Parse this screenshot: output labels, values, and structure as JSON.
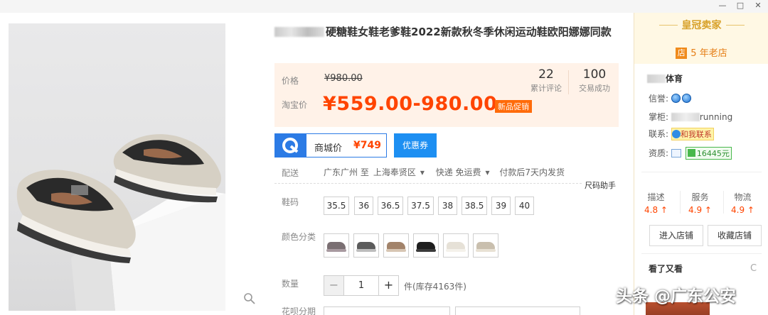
{
  "window": {
    "minimize_label": "—",
    "maximize_label": "□",
    "close_label": "✕"
  },
  "product": {
    "title": "硬糖鞋女鞋老爹鞋2022新款秋冬季休闲运动鞋欧阳娜娜同款",
    "price_label": "价格",
    "original_price": "¥980.00",
    "taobao_price_label": "淘宝价",
    "taobao_price": "¥559.00-980.00",
    "promo_tag": "新品促销",
    "reviews_count": "22",
    "reviews_label": "累计评论",
    "trades_count": "100",
    "trades_label": "交易成功",
    "mall_price_label": "商城价",
    "mall_price": "¥749",
    "coupon_label": "优惠券"
  },
  "delivery": {
    "label": "配送",
    "from": "广东广州 至",
    "to": "上海奉贤区",
    "express": "快递 免运费",
    "ship_time": "付款后7天内发货",
    "size_helper": "尺码助手"
  },
  "sizes": {
    "label": "鞋码",
    "options": [
      "35.5",
      "36",
      "36.5",
      "37.5",
      "38",
      "38.5",
      "39",
      "40"
    ]
  },
  "colors": {
    "label": "颜色分类",
    "swatches": [
      {
        "name": "swatch-1",
        "upper": "#7a6f72",
        "sole": "#a89aa0"
      },
      {
        "name": "swatch-2",
        "upper": "#5b5b5b",
        "sole": "#bdbdbd"
      },
      {
        "name": "swatch-3",
        "upper": "#a2836a",
        "sole": "#d7c6b3"
      },
      {
        "name": "swatch-4",
        "upper": "#1e1e1e",
        "sole": "#3a3a3a"
      },
      {
        "name": "swatch-5",
        "upper": "#e6e1d7",
        "sole": "#f4f1ea"
      },
      {
        "name": "swatch-6",
        "upper": "#c9bfae",
        "sole": "#e8e1d4"
      }
    ]
  },
  "quantity": {
    "label": "数量",
    "minus": "−",
    "value": "1",
    "plus": "+",
    "stock_text": "件(库存4163件)"
  },
  "installment": {
    "label": "花呗分期"
  },
  "seller": {
    "crown_label": "皇冠卖家",
    "years_tag": "店",
    "years_text": "5 年老店",
    "shop_name_suffix": "体育",
    "credit_label": "信誉:",
    "owner_label": "掌柜:",
    "owner_suffix": "running",
    "contact_label": "联系:",
    "contact_button": "和我联系",
    "qualification_label": "资质:",
    "deposit": "16445元",
    "scores": [
      {
        "key": "描述",
        "value": "4.8 ↑"
      },
      {
        "key": "服务",
        "value": "4.9 ↑"
      },
      {
        "key": "物流",
        "value": "4.9 ↑"
      }
    ],
    "enter_shop": "进入店铺",
    "favorite_shop": "收藏店铺",
    "seen_title": "看了又看",
    "refresh_icon": "C"
  },
  "watermark": "头条 @广东公安",
  "colors_theme": {
    "accent": "#ff4400",
    "mall_blue": "#2c7be5",
    "gold": "#d8a12a"
  }
}
